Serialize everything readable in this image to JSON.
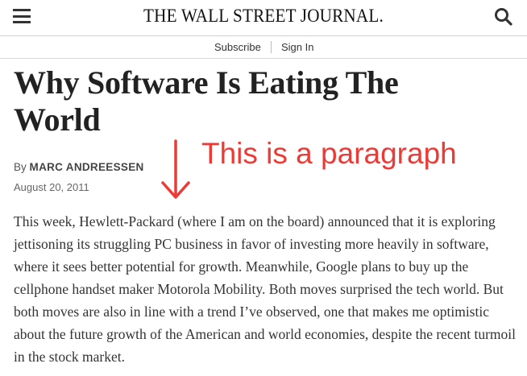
{
  "header": {
    "masthead": "THE WALL STREET JOURNAL.",
    "menu_icon": "hamburger-menu-icon",
    "search_icon": "search-icon"
  },
  "subnav": {
    "subscribe": "Subscribe",
    "sign_in": "Sign In"
  },
  "article": {
    "headline": "Why Software Is Eating The World",
    "byline_prefix": "By",
    "author": "MARC ANDREESSEN",
    "date": "August 20, 2011",
    "body": "This week, Hewlett-Packard (where I am on the board) announced that it is exploring jettisoning its struggling PC business in favor of investing more heavily in software, where it sees better potential for growth. Meanwhile, Google plans to buy up the cellphone handset maker Motorola Mobility. Both moves surprised the tech world. But both moves are also in line with a trend I’ve observed, one that makes me optimistic about the future growth of the American and world economies, despite the recent turmoil in the stock market."
  },
  "annotation": {
    "text": "This is a paragraph",
    "color": "#ec3b36",
    "arrow_icon": "down-arrow-icon"
  }
}
